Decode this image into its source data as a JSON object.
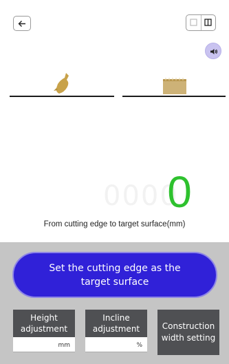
{
  "header": {
    "back_icon": "arrow-left-icon",
    "view_toggle_icons": [
      "single-view-icon",
      "split-view-icon"
    ],
    "sound_icon": "speaker-icon"
  },
  "diagram": {
    "left_icon": "bucket-icon",
    "right_icon": "target-surface-icon",
    "accent_color": "#c8a24a"
  },
  "measurement": {
    "ghost_digits": "0000",
    "value": "0",
    "value_color": "#2ec12e",
    "label": "From cutting edge to target surface(mm)"
  },
  "actions": {
    "set_target_label": "Set the cutting edge as the target surface",
    "button_color": "#3021d8"
  },
  "adjustments": {
    "height": {
      "label": "Height adjustment",
      "unit": "mm",
      "value": ""
    },
    "incline": {
      "label": "Incline adjustment",
      "unit": "%",
      "value": ""
    },
    "construction_label": "Construction width setting"
  }
}
